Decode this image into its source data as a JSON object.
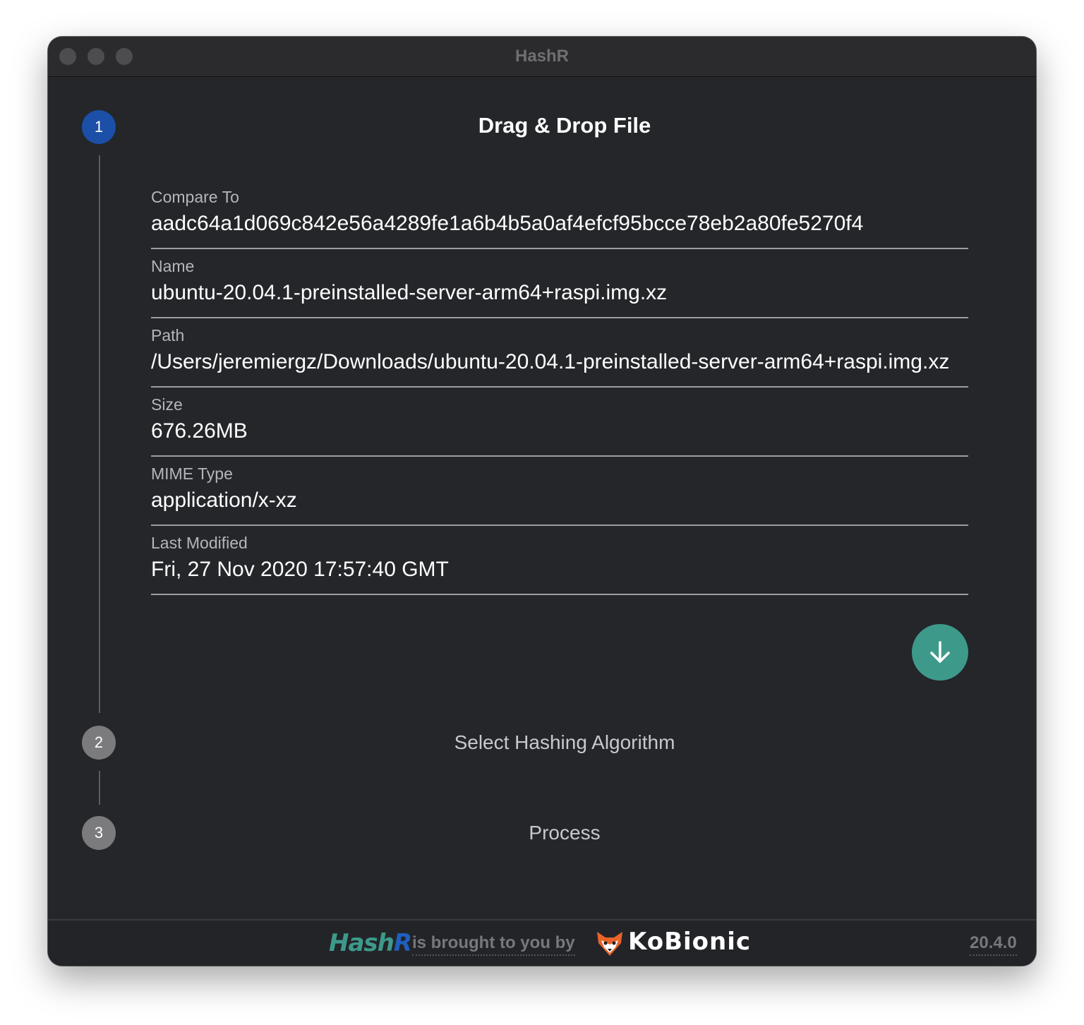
{
  "window": {
    "title": "HashR"
  },
  "steps": [
    {
      "number": "1",
      "title": "Drag & Drop File",
      "state": "active"
    },
    {
      "number": "2",
      "title": "Select Hashing Algorithm",
      "state": "inactive"
    },
    {
      "number": "3",
      "title": "Process",
      "state": "inactive"
    }
  ],
  "fields": [
    {
      "label": "Compare To",
      "value": "aadc64a1d069c842e56a4289fe1a6b4b5a0af4efcf95bcce78eb2a80fe5270f4"
    },
    {
      "label": "Name",
      "value": "ubuntu-20.04.1-preinstalled-server-arm64+raspi.img.xz"
    },
    {
      "label": "Path",
      "value": "/Users/jeremiergz/Downloads/ubuntu-20.04.1-preinstalled-server-arm64+raspi.img.xz"
    },
    {
      "label": "Size",
      "value": "676.26MB"
    },
    {
      "label": "MIME Type",
      "value": "application/x-xz"
    },
    {
      "label": "Last Modified",
      "value": "Fri, 27 Nov 2020 17:57:40 GMT"
    }
  ],
  "next_button": {
    "icon": "arrow-down-icon"
  },
  "footer": {
    "logo_part1": "Hash",
    "logo_part2": "R",
    "tagline": "is brought to you by",
    "company": "KoBionic",
    "version": "20.4.0"
  },
  "colors": {
    "accent_blue": "#1b4fa8",
    "accent_teal": "#3d9a8b",
    "background": "#24262a"
  }
}
